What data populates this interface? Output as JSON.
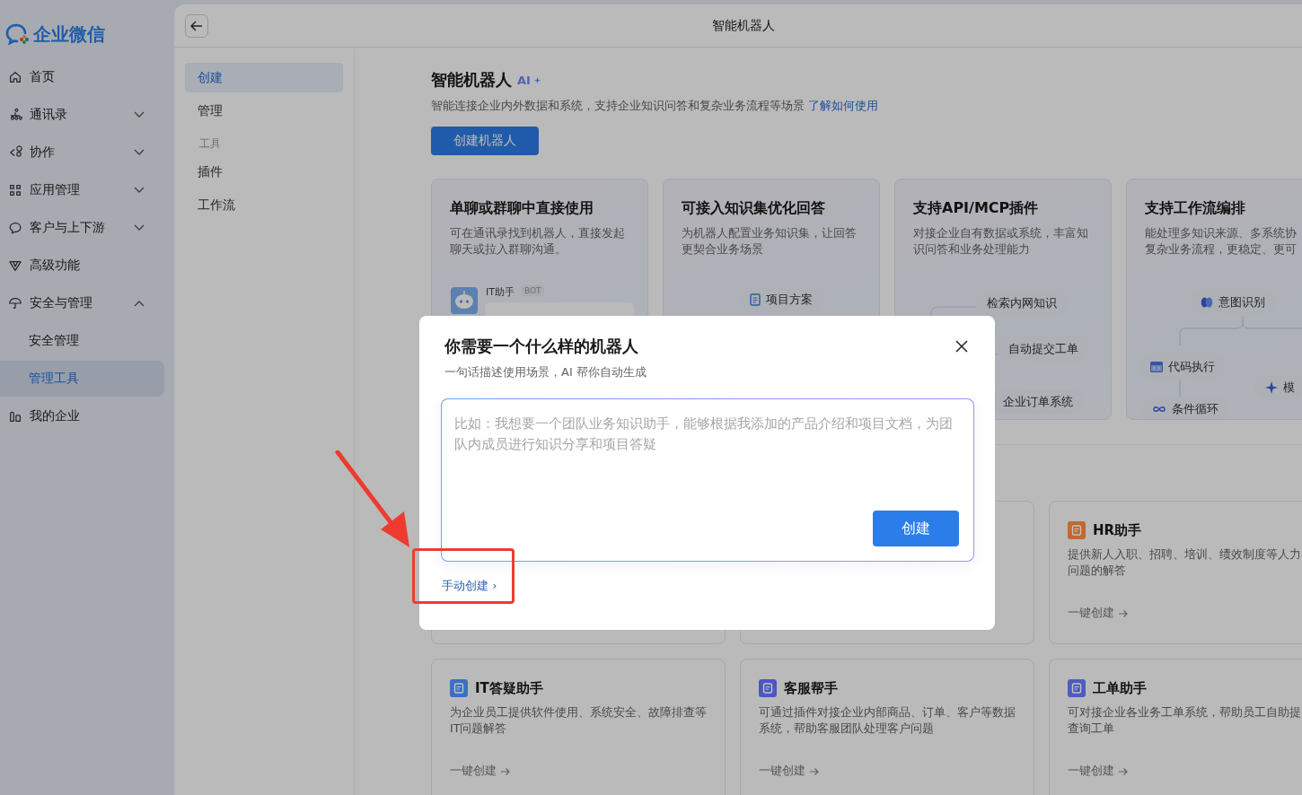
{
  "logo": {
    "text": "企业微信"
  },
  "sidebar": {
    "items": [
      {
        "label": "首页",
        "selected": false
      },
      {
        "label": "通讯录",
        "expanded": false,
        "selected": false
      },
      {
        "label": "协作",
        "expanded": false,
        "selected": false
      },
      {
        "label": "应用管理",
        "expanded": false,
        "selected": false
      },
      {
        "label": "客户与上下游",
        "expanded": false,
        "selected": false
      },
      {
        "label": "高级功能",
        "selected": false
      },
      {
        "label": "安全与管理",
        "expanded": true,
        "selected": false,
        "children": [
          {
            "label": "安全管理",
            "selected": false
          },
          {
            "label": "管理工具",
            "selected": true
          }
        ]
      },
      {
        "label": "我的企业",
        "selected": false
      }
    ]
  },
  "header": {
    "title": "智能机器人"
  },
  "subnav": [
    {
      "kind": "item",
      "label": "创建",
      "selected": true
    },
    {
      "kind": "item",
      "label": "管理",
      "selected": false
    },
    {
      "kind": "heading",
      "label": "工具"
    },
    {
      "kind": "item",
      "label": "插件",
      "selected": false
    },
    {
      "kind": "item",
      "label": "工作流",
      "selected": false
    }
  ],
  "page": {
    "title": "智能机器人",
    "badge": "AI",
    "description": "智能连接企业内外数据和系统，支持企业知识问答和复杂业务流程等场景",
    "link": "了解如何使用",
    "button": "创建机器人"
  },
  "features": [
    {
      "kind": "chat",
      "title": "单聊或群聊中直接使用",
      "description": [
        "可在通讯录找到机器人，直接发起",
        "聊天或拉入群聊沟通。"
      ],
      "bot_name": "IT助手",
      "bot_tag": "BOT"
    },
    {
      "kind": "knowledge",
      "title": "可接入知识集优化回答",
      "description": [
        "为机器人配置业务知识集，让回答",
        "更契合业务场景"
      ],
      "chips": [
        "项目方案"
      ]
    },
    {
      "kind": "plugins",
      "title": "支持API/MCP插件",
      "description": [
        "对接企业自有数据或系统，丰富知",
        "识问答和业务处理能力"
      ],
      "chips": [
        "检索内网知识",
        "自动提交工单",
        "企业订单系统"
      ]
    },
    {
      "kind": "workflow",
      "title": "支持工作流编排",
      "description": [
        "能处理多知识来源、多系统协",
        "复杂业务流程，更稳定、更可"
      ],
      "chips": [
        "意图识别",
        "代码执行",
        "模",
        "条件循环"
      ]
    }
  ],
  "templates": [
    {
      "kind": "covered"
    },
    {
      "kind": "covered"
    },
    {
      "kind": "template",
      "title": "HR助手",
      "description": [
        "提供新人入职、招聘、培训、绩效制度等人力",
        "问题的解答"
      ],
      "action": "一键创建",
      "color": "#c2692f"
    },
    {
      "kind": "template",
      "title": "IT答疑助手",
      "description": [
        "为企业员工提供软件使用、系统安全、故障排查等",
        "IT问题解答"
      ],
      "action": "一键创建",
      "color": "#3b6fc4"
    },
    {
      "kind": "template",
      "title": "客服帮手",
      "description": [
        "可通过插件对接企业内部商品、订单、客户等数据",
        "系统，帮助客服团队处理客户问题"
      ],
      "action": "一键创建",
      "color": "#4d57c0"
    },
    {
      "kind": "template",
      "title": "工单助手",
      "description": [
        "可对接企业各业务工单系统，帮助员工自助提",
        "查询工单"
      ],
      "action": "一键创建",
      "color": "#4f5bbf"
    }
  ],
  "dialog": {
    "title": "你需要一个什么样的机器人",
    "subtitle": "一句话描述使用场景，AI 帮你自动生成",
    "placeholder": "比如：我想要一个团队业务知识助手，能够根据我添加的产品介绍和项目文档，为团队内成员进行知识分享和项目答疑",
    "create": "创建",
    "manual": "手动创建",
    "manual_arrow": "›"
  }
}
